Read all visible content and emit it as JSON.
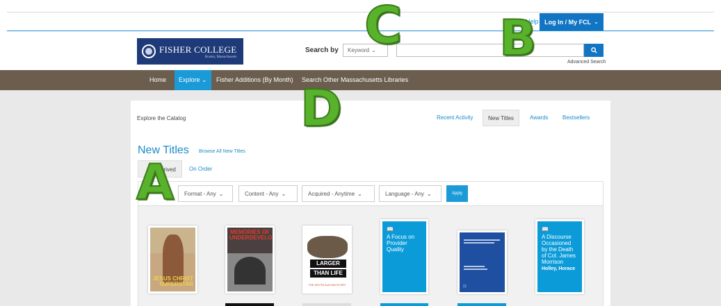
{
  "header": {
    "help_link": "Help",
    "login_label": "Log In / My FCL",
    "logo": {
      "name": "FISHER COLLEGE",
      "sub": "Boston, Massachusetts"
    },
    "search": {
      "label": "Search by",
      "field_selected": "Keyword",
      "input_value": "",
      "button_icon": "search-icon",
      "advanced_link": "Advanced Search"
    }
  },
  "nav": {
    "items": [
      {
        "label": "Home"
      },
      {
        "label": "Explore"
      },
      {
        "label": "Fisher Additions (By Month)"
      },
      {
        "label": "Search Other Massachusetts Libraries"
      }
    ]
  },
  "panel": {
    "title": "Explore the Catalog",
    "tabs": [
      {
        "label": "Recent Activity"
      },
      {
        "label": "New Titles",
        "active": true
      },
      {
        "label": "Awards"
      },
      {
        "label": "Bestsellers"
      }
    ],
    "heading": "New Titles",
    "browse_link": "Browse All New Titles",
    "subtabs": [
      {
        "label": "Just Arrived",
        "active": true
      },
      {
        "label": "On Order"
      }
    ],
    "filters": [
      {
        "label": "Format - Any"
      },
      {
        "label": "Content - Any"
      },
      {
        "label": "Acquired - Anytime"
      },
      {
        "label": "Language - Any"
      }
    ],
    "apply_label": "Apply",
    "covers": [
      {
        "title_text": "JESUS CHRIST SUPERSTAR"
      },
      {
        "title_text": "MEMORIES OF UNDERDEVELOPMENT"
      },
      {
        "band1": "LARGER",
        "band2": "THAN LIFE",
        "sub": "THE KEVYN AUCOIN STORY"
      },
      {
        "title": "A Focus on Provider Quality",
        "author": ""
      },
      {
        "title": "",
        "publisher_mark": "R"
      },
      {
        "title": "A Discourse Occasioned by the Death of Col. James Morrison",
        "author": "Holley, Horace"
      }
    ]
  },
  "overlay_labels": {
    "a": "A",
    "b": "B",
    "c": "C",
    "d": "D"
  },
  "colors": {
    "accent": "#1175c4",
    "nav_bg": "#6b5e4f",
    "explore_bg": "#1a9bd8",
    "overlay": "#58b22c"
  }
}
